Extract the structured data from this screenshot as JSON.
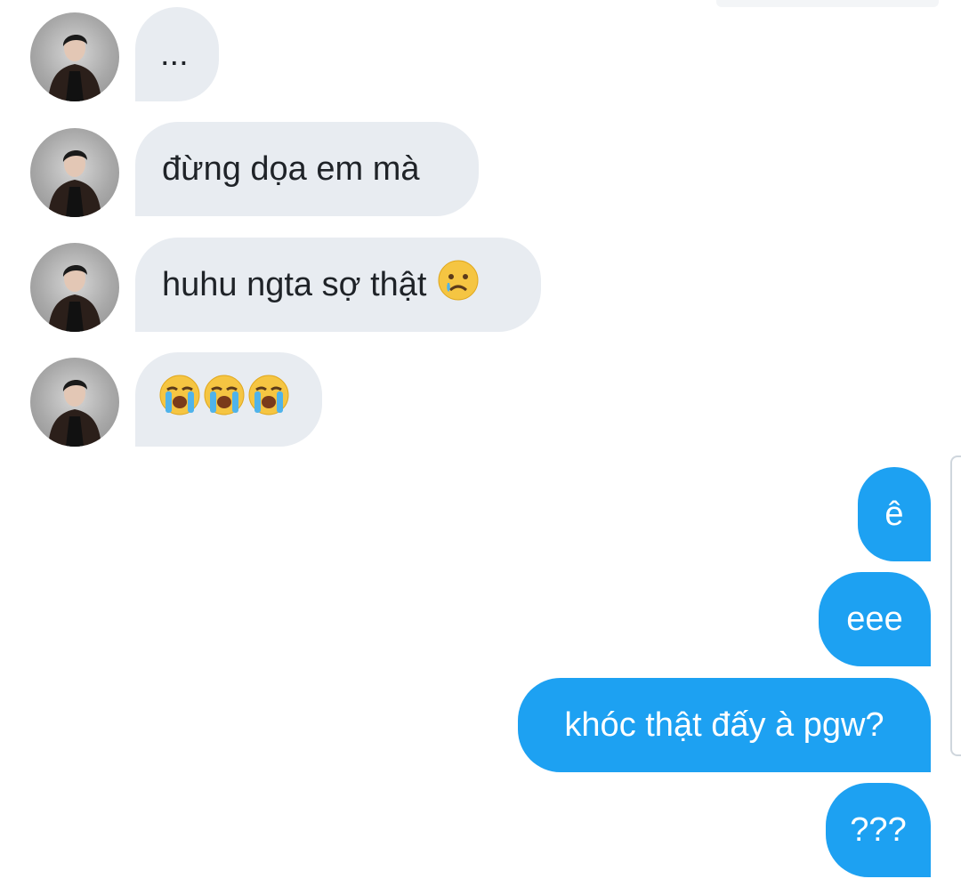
{
  "thread": {
    "incoming": [
      {
        "text": "...",
        "avatar": "contact-avatar"
      },
      {
        "text": "đừng dọa em mà",
        "avatar": "contact-avatar"
      },
      {
        "text": "huhu ngta sợ thật",
        "emoji": [
          "crying-face-emoji"
        ],
        "avatar": "contact-avatar"
      },
      {
        "text": "",
        "emoji": [
          "loudly-crying-face-emoji",
          "loudly-crying-face-emoji",
          "loudly-crying-face-emoji"
        ],
        "avatar": "contact-avatar"
      }
    ],
    "outgoing": [
      {
        "text": "ê"
      },
      {
        "text": "eee"
      },
      {
        "text": "khóc thật đấy à pgw?"
      },
      {
        "text": "???"
      }
    ]
  },
  "colors": {
    "incoming_bubble": "#e8ecf1",
    "incoming_text": "#1f2328",
    "outgoing_bubble": "#1da1f2",
    "outgoing_text": "#ffffff"
  }
}
